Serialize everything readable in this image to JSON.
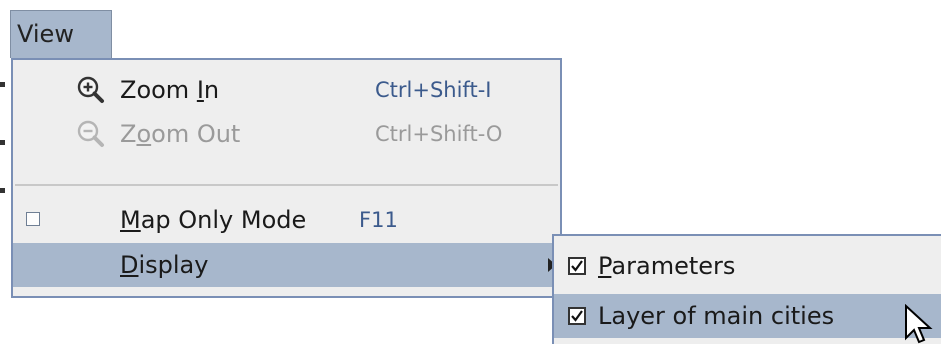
{
  "menubar": {
    "view": {
      "label_mn": "V",
      "label_rest": "iew"
    }
  },
  "menu": {
    "items": [
      {
        "label_pre": "Zoom ",
        "label_mn": "I",
        "label_post": "n",
        "accelerator": "Ctrl+Shift-I",
        "icon": "zoom-in-icon",
        "enabled": true
      },
      {
        "label_pre": "Z",
        "label_mn": "o",
        "label_post": "om Out",
        "accelerator": "Ctrl+Shift-O",
        "icon": "zoom-out-icon",
        "enabled": false
      },
      {
        "label_pre": "",
        "label_mn": "M",
        "label_post": "ap Only Mode",
        "accelerator": "F11",
        "checked": false
      },
      {
        "label_pre": "",
        "label_mn": "D",
        "label_post": "isplay",
        "has_submenu": true,
        "highlighted": true
      }
    ]
  },
  "submenu": {
    "items": [
      {
        "label_pre": "",
        "label_mn": "P",
        "label_post": "arameters",
        "checked": true
      },
      {
        "label_pre": "Layer of main cities",
        "label_mn": "",
        "label_post": "",
        "checked": true,
        "highlighted": true
      }
    ]
  },
  "colors": {
    "highlight": "#a7b7cc",
    "menu_bg": "#eeeeee",
    "border": "#7a8fb5"
  }
}
